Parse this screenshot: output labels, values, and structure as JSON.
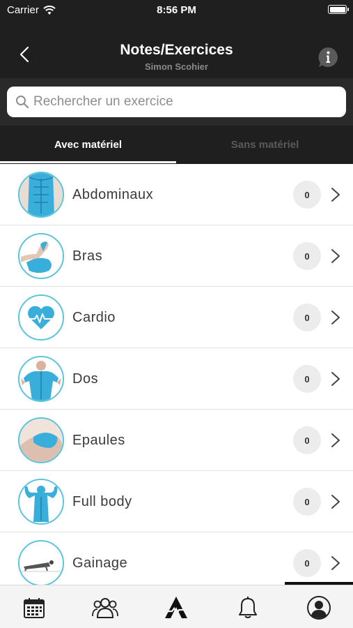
{
  "status": {
    "carrier": "Carrier",
    "time": "8:56 PM"
  },
  "nav": {
    "title": "Notes/Exercices",
    "subtitle": "Simon Scohier"
  },
  "search": {
    "placeholder": "Rechercher un exercice"
  },
  "tabs": [
    {
      "label": "Avec matériel",
      "active": true
    },
    {
      "label": "Sans matériel",
      "active": false
    }
  ],
  "items": [
    {
      "label": "Abdominaux",
      "count": "0",
      "icon": "abs-muscle-icon"
    },
    {
      "label": "Bras",
      "count": "0",
      "icon": "arm-muscle-icon"
    },
    {
      "label": "Cardio",
      "count": "0",
      "icon": "heart-pulse-icon"
    },
    {
      "label": "Dos",
      "count": "0",
      "icon": "back-muscle-icon"
    },
    {
      "label": "Epaules",
      "count": "0",
      "icon": "shoulder-muscle-icon"
    },
    {
      "label": "Full body",
      "count": "0",
      "icon": "full-body-icon"
    },
    {
      "label": "Gainage",
      "count": "0",
      "icon": "plank-icon"
    }
  ],
  "tabbar": [
    "calendar-icon",
    "group-icon",
    "app-logo-icon",
    "bell-icon",
    "profile-icon"
  ],
  "colors": {
    "accent": "#5bc4dd",
    "header_bg": "#1f1f1f",
    "muscle_blue": "#3aaedb"
  }
}
